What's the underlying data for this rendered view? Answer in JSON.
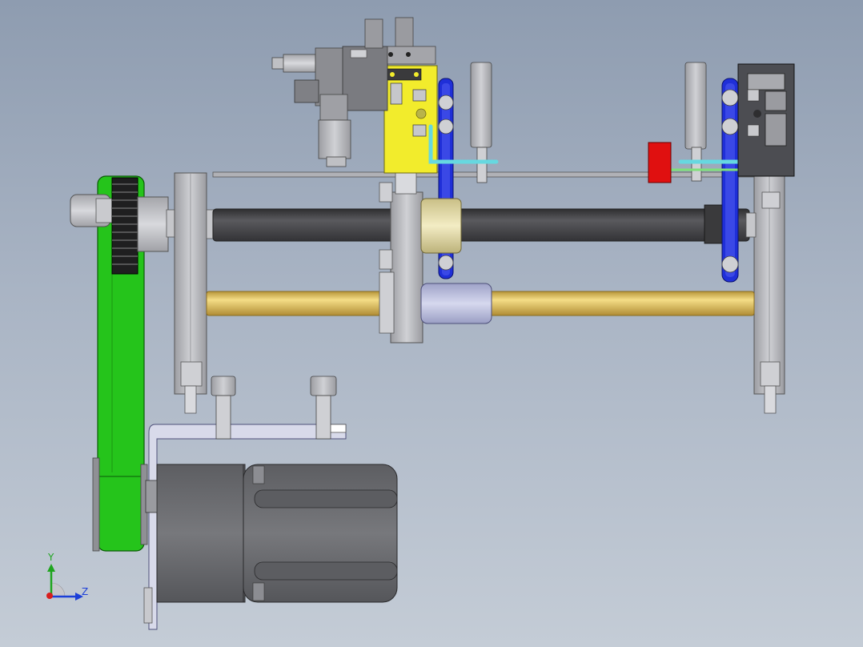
{
  "triad": {
    "y_label": "Y",
    "z_label": "Z",
    "x_color": "#d81e1e",
    "y_color": "#1fa51f",
    "z_color": "#1c3fd8"
  },
  "colors": {
    "background_top": "#8e9cb0",
    "background_bottom": "#c4ccd6",
    "belt_green": "#25c41b",
    "gold_rod": "#e2c462",
    "dark_shaft": "#4a4a4c",
    "yellow_plate": "#f2ec2c",
    "blue_belt": "#1f2fd8",
    "red_block": "#e01010",
    "cyan_tube": "#66d8e0",
    "motor_grey": "#6b6c70",
    "frame_grey": "#b8b9bd",
    "bearing_cream": "#e8e0b4"
  },
  "parts": [
    "timing-belt",
    "drive-pulley",
    "motor",
    "motor-bracket",
    "left-frame-plate",
    "right-frame-plate",
    "ball-screw-shaft",
    "linear-guide-rod",
    "carriage-block",
    "cylinder-assembly",
    "yellow-mount-plate",
    "blue-belt-left",
    "blue-belt-right",
    "red-sensor-block",
    "cyan-air-tube",
    "aluminum-profile"
  ]
}
